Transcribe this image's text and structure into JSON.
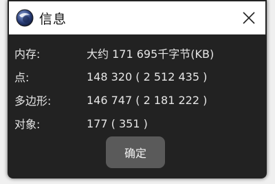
{
  "window": {
    "title": "信息",
    "app_icon": "cinema4d-logo-icon",
    "close_icon": "close-icon"
  },
  "info": {
    "rows": [
      {
        "label": "内存:",
        "value": "大约 171 695千字节(KB)"
      },
      {
        "label": "点:",
        "value": "148 320 ( 2 512 435 )"
      },
      {
        "label": "多边形:",
        "value": "146 747 ( 2 181 222 )"
      },
      {
        "label": "对象:",
        "value": "177 ( 351 )"
      }
    ]
  },
  "buttons": {
    "ok_label": "确定"
  },
  "colors": {
    "dialog_bg": "#222222",
    "titlebar_bg": "#ffffff",
    "button_bg": "#5a5a5a",
    "text": "#e6e6e6"
  }
}
